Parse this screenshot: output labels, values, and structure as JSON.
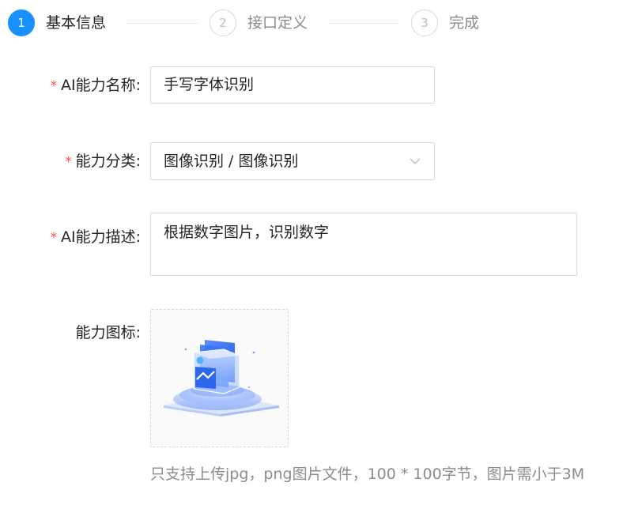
{
  "steps": [
    {
      "number": "1",
      "title": "基本信息",
      "status": "active"
    },
    {
      "number": "2",
      "title": "接口定义",
      "status": "wait"
    },
    {
      "number": "3",
      "title": "完成",
      "status": "wait"
    }
  ],
  "form": {
    "required_mark": "*",
    "name": {
      "label": "AI能力名称:",
      "value": "手写字体识别"
    },
    "category": {
      "label": "能力分类:",
      "value": "图像识别 / 图像识别"
    },
    "description": {
      "label": "AI能力描述:",
      "value": "根据数字图片，识别数字"
    },
    "icon": {
      "label": "能力图标:",
      "image": "ai-ability-icon-3d-image"
    },
    "hint": "只支持上传jpg，png图片文件，100 * 100字节，图片需小于3M"
  },
  "colors": {
    "primary": "#1890ff",
    "required": "#ff4d4f",
    "border": "#d9d9d9",
    "muted": "#8c8c8c"
  }
}
